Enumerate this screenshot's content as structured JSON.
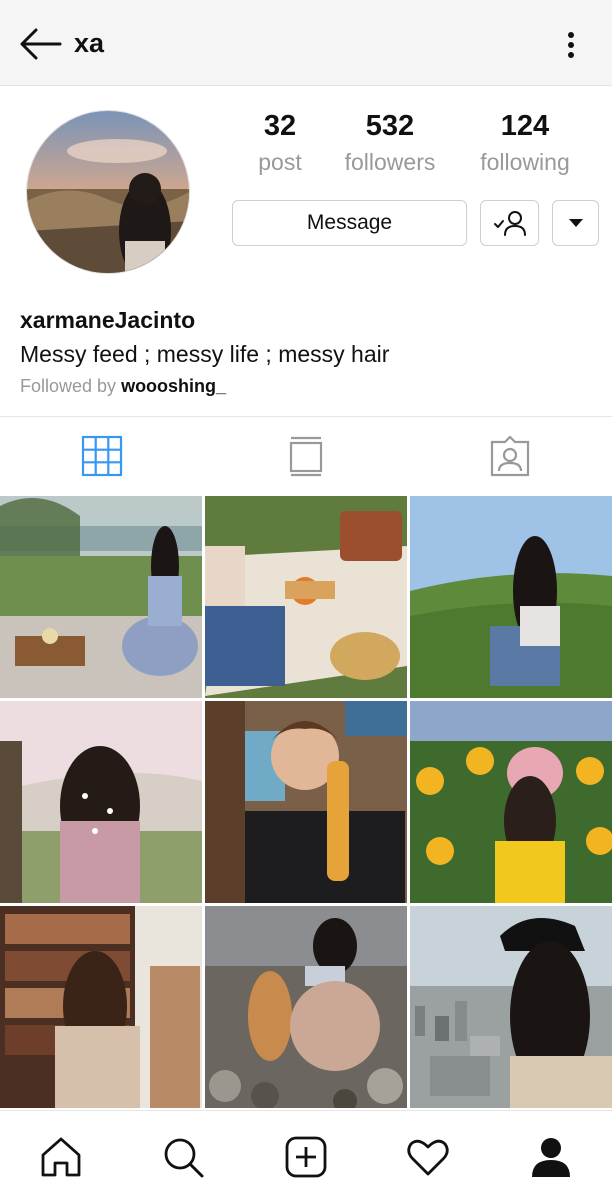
{
  "header": {
    "title": "xa",
    "back_icon": "arrow-left-icon",
    "menu_icon": "more-vertical-icon"
  },
  "profile": {
    "stats": [
      {
        "value": "32",
        "label": "post"
      },
      {
        "value": "532",
        "label": "followers"
      },
      {
        "value": "124",
        "label": "following"
      }
    ],
    "message_label": "Message",
    "username": "xarmaneJacinto",
    "bio": "Messy feed ; messy life ; messy hair",
    "followed_by_prefix": "Followed by ",
    "followed_by_user": "woooshing_"
  },
  "tabs": [
    {
      "icon": "grid-icon",
      "active": true
    },
    {
      "icon": "feed-icon",
      "active": false
    },
    {
      "icon": "tagged-icon",
      "active": false
    }
  ],
  "colors": {
    "accent": "#3897f0",
    "muted": "#999999",
    "border": "#cfcfcf"
  },
  "nav": [
    "home-icon",
    "search-icon",
    "new-post-icon",
    "activity-heart-icon",
    "profile-icon"
  ]
}
